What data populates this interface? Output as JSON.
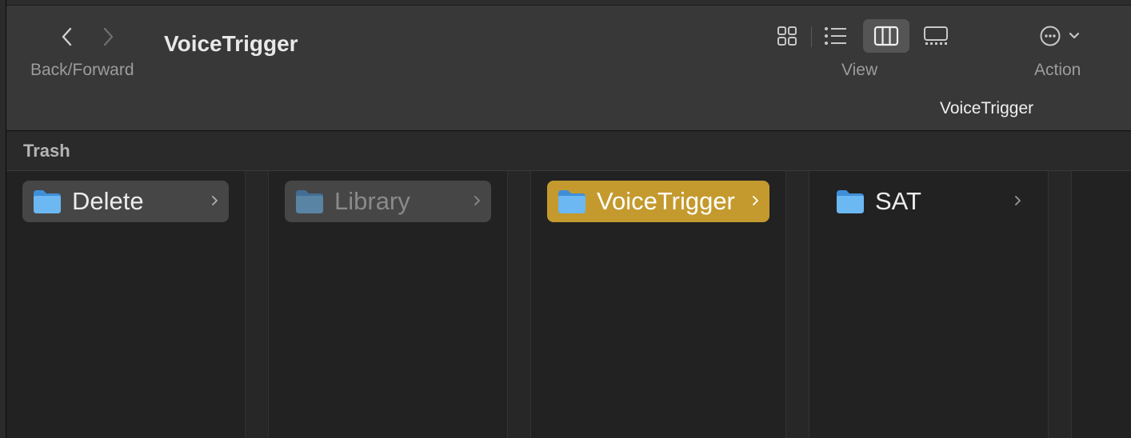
{
  "window": {
    "title": "VoiceTrigger"
  },
  "toolbar": {
    "back_forward_label": "Back/Forward",
    "view_label": "View",
    "action_label": "Action",
    "active_view": "columns",
    "icons": {
      "back": "chevron-left-icon",
      "forward": "chevron-right-icon",
      "icon_view": "grid-icon",
      "list_view": "list-icon",
      "column_view": "columns-icon",
      "gallery_view": "gallery-icon",
      "action": "ellipsis-circle-icon"
    }
  },
  "path": {
    "current_folder": "VoiceTrigger"
  },
  "path_bar": {
    "label": "Trash"
  },
  "columns": [
    {
      "items": [
        {
          "name": "Delete",
          "selected": "gray",
          "dimmed": false,
          "has_children": true
        }
      ]
    },
    {
      "items": [
        {
          "name": "Library",
          "selected": "gray",
          "dimmed": true,
          "has_children": true
        }
      ]
    },
    {
      "items": [
        {
          "name": "VoiceTrigger",
          "selected": "accent",
          "dimmed": false,
          "has_children": true
        }
      ]
    },
    {
      "items": [
        {
          "name": "SAT",
          "selected": "none",
          "dimmed": false,
          "has_children": true
        }
      ]
    }
  ],
  "colors": {
    "accent_selection": "#c49a2e",
    "inactive_selection": "#464646",
    "folder_blue": "#5fb0ee"
  }
}
